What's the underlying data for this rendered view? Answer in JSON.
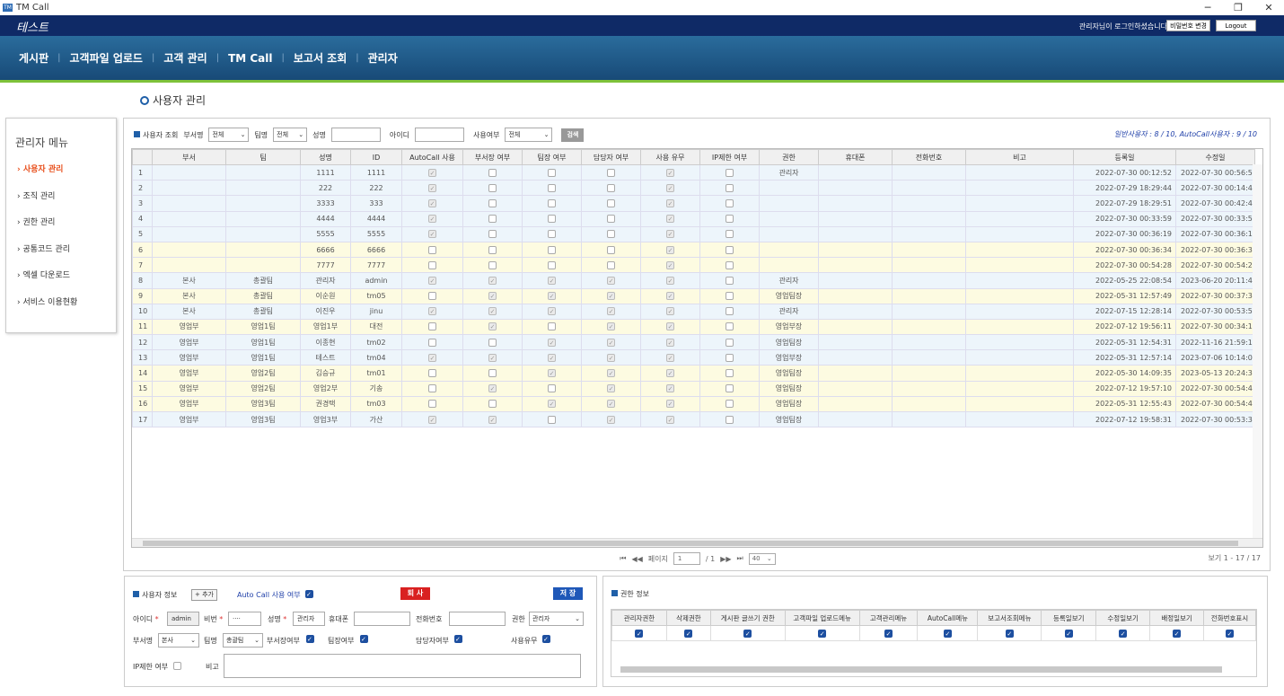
{
  "window": {
    "title": "TM Call",
    "icon": "app-icon",
    "controls": [
      "─",
      "❐",
      "✕"
    ]
  },
  "topbar": {
    "brand": "테스트",
    "login_text": "관리자님이 로그인하셨습니다",
    "change_pw": "비밀번호 변경",
    "logout": "Logout"
  },
  "nav": [
    "게시판",
    "고객파일 업로드",
    "고객 관리",
    "TM Call",
    "보고서 조회",
    "관리자"
  ],
  "page_title": "사용자 관리",
  "sidebar": {
    "title": "관리자 메뉴",
    "items": [
      "사용자 관리",
      "조직 관리",
      "권한 관리",
      "공통코드 관리",
      "엑셀 다운로드",
      "서비스 이용현황"
    ],
    "active_index": 0
  },
  "filter": {
    "section": "사용자 조회",
    "dept_label": "부서명",
    "dept_value": "전체",
    "team_label": "팀명",
    "team_value": "전체",
    "name_label": "성명",
    "id_label": "아이디",
    "use_label": "사용여부",
    "use_value": "전체",
    "search_btn": "검색"
  },
  "usercount": "일반사용자 : 8 / 10,  AutoCall사용자 : 9 / 10",
  "grid": {
    "columns": [
      "",
      "부서",
      "팀",
      "성명",
      "ID",
      "AutoCall 사용",
      "부서장 여부",
      "팀장 여부",
      "담당자 여부",
      "사용 유무",
      "IP제한 여부",
      "권한",
      "휴대폰",
      "전화번호",
      "비고",
      "등록일",
      "수정일"
    ],
    "rows": [
      {
        "no": "1",
        "dept": "",
        "team": "",
        "name": "1111",
        "id": "1111",
        "auto": true,
        "head": false,
        "lead": false,
        "mgr": false,
        "use": true,
        "ip": false,
        "role": "관리자",
        "reg": "2022-07-30 00:12:52",
        "mod": "2022-07-30 00:56:5",
        "color": "b"
      },
      {
        "no": "2",
        "dept": "",
        "team": "",
        "name": "222",
        "id": "222",
        "auto": true,
        "head": false,
        "lead": false,
        "mgr": false,
        "use": true,
        "ip": false,
        "role": "",
        "reg": "2022-07-29 18:29:44",
        "mod": "2022-07-30 00:14:4",
        "color": "b"
      },
      {
        "no": "3",
        "dept": "",
        "team": "",
        "name": "3333",
        "id": "333",
        "auto": true,
        "head": false,
        "lead": false,
        "mgr": false,
        "use": true,
        "ip": false,
        "role": "",
        "reg": "2022-07-29 18:29:51",
        "mod": "2022-07-30 00:42:4",
        "color": "b"
      },
      {
        "no": "4",
        "dept": "",
        "team": "",
        "name": "4444",
        "id": "4444",
        "auto": true,
        "head": false,
        "lead": false,
        "mgr": false,
        "use": true,
        "ip": false,
        "role": "",
        "reg": "2022-07-30 00:33:59",
        "mod": "2022-07-30 00:33:5",
        "color": "b"
      },
      {
        "no": "5",
        "dept": "",
        "team": "",
        "name": "5555",
        "id": "5555",
        "auto": true,
        "head": false,
        "lead": false,
        "mgr": false,
        "use": true,
        "ip": false,
        "role": "",
        "reg": "2022-07-30 00:36:19",
        "mod": "2022-07-30 00:36:1",
        "color": "b"
      },
      {
        "no": "6",
        "dept": "",
        "team": "",
        "name": "6666",
        "id": "6666",
        "auto": false,
        "head": false,
        "lead": false,
        "mgr": false,
        "use": true,
        "ip": false,
        "role": "",
        "reg": "2022-07-30 00:36:34",
        "mod": "2022-07-30 00:36:3",
        "color": "y"
      },
      {
        "no": "7",
        "dept": "",
        "team": "",
        "name": "7777",
        "id": "7777",
        "auto": false,
        "head": false,
        "lead": false,
        "mgr": false,
        "use": true,
        "ip": false,
        "role": "",
        "reg": "2022-07-30 00:54:28",
        "mod": "2022-07-30 00:54:2",
        "color": "y"
      },
      {
        "no": "8",
        "dept": "본사",
        "team": "총괄팀",
        "name": "관리자",
        "id": "admin",
        "auto": true,
        "head": true,
        "lead": true,
        "mgr": true,
        "use": true,
        "ip": false,
        "role": "관리자",
        "reg": "2022-05-25 22:08:54",
        "mod": "2023-06-20 20:11:4",
        "color": "b"
      },
      {
        "no": "9",
        "dept": "본사",
        "team": "총괄팀",
        "name": "이순원",
        "id": "tm05",
        "auto": false,
        "head": true,
        "lead": true,
        "mgr": true,
        "use": true,
        "ip": false,
        "role": "영업팀장",
        "reg": "2022-05-31 12:57:49",
        "mod": "2022-07-30 00:37:3",
        "color": "y"
      },
      {
        "no": "10",
        "dept": "본사",
        "team": "총괄팀",
        "name": "이진우",
        "id": "jinu",
        "auto": true,
        "head": true,
        "lead": true,
        "mgr": true,
        "use": true,
        "ip": false,
        "role": "관리자",
        "reg": "2022-07-15 12:28:14",
        "mod": "2022-07-30 00:53:5",
        "color": "b"
      },
      {
        "no": "11",
        "dept": "영업부",
        "team": "영업1팀",
        "name": "영업1부",
        "id": "대전",
        "auto": false,
        "head": true,
        "lead": false,
        "mgr": true,
        "use": true,
        "ip": false,
        "role": "영업부장",
        "reg": "2022-07-12 19:56:11",
        "mod": "2022-07-30 00:34:1",
        "color": "y"
      },
      {
        "no": "12",
        "dept": "영업부",
        "team": "영업1팀",
        "name": "이종현",
        "id": "tm02",
        "auto": false,
        "head": false,
        "lead": true,
        "mgr": true,
        "use": true,
        "ip": false,
        "role": "영업팀장",
        "reg": "2022-05-31 12:54:31",
        "mod": "2022-11-16 21:59:1",
        "color": "b"
      },
      {
        "no": "13",
        "dept": "영업부",
        "team": "영업1팀",
        "name": "테스트",
        "id": "tm04",
        "auto": true,
        "head": true,
        "lead": true,
        "mgr": true,
        "use": true,
        "ip": false,
        "role": "영업부장",
        "reg": "2022-05-31 12:57:14",
        "mod": "2023-07-06 10:14:0",
        "color": "b"
      },
      {
        "no": "14",
        "dept": "영업부",
        "team": "영업2팀",
        "name": "김승규",
        "id": "tm01",
        "auto": false,
        "head": false,
        "lead": true,
        "mgr": true,
        "use": true,
        "ip": false,
        "role": "영업팀장",
        "reg": "2022-05-30 14:09:35",
        "mod": "2023-05-13 20:24:3",
        "color": "y"
      },
      {
        "no": "15",
        "dept": "영업부",
        "team": "영업2팀",
        "name": "영업2부",
        "id": "기송",
        "auto": false,
        "head": true,
        "lead": false,
        "mgr": true,
        "use": true,
        "ip": false,
        "role": "영업팀장",
        "reg": "2022-07-12 19:57:10",
        "mod": "2022-07-30 00:54:4",
        "color": "y"
      },
      {
        "no": "16",
        "dept": "영업부",
        "team": "영업3팀",
        "name": "권경택",
        "id": "tm03",
        "auto": false,
        "head": false,
        "lead": true,
        "mgr": true,
        "use": true,
        "ip": false,
        "role": "영업팀장",
        "reg": "2022-05-31 12:55:43",
        "mod": "2022-07-30 00:54:4",
        "color": "y"
      },
      {
        "no": "17",
        "dept": "영업부",
        "team": "영업3팀",
        "name": "영업3부",
        "id": "가산",
        "auto": true,
        "head": true,
        "lead": false,
        "mgr": true,
        "use": true,
        "ip": false,
        "role": "영업팀장",
        "reg": "2022-07-12 19:58:31",
        "mod": "2022-07-30 00:53:3",
        "color": "b"
      }
    ]
  },
  "pager": {
    "first": "⏮",
    "prev": "◀◀",
    "page_label": "페이지",
    "page_value": "1",
    "total": "/ 1",
    "next": "▶▶",
    "last": "⏭",
    "page_size": "40",
    "info": "보기 1 - 17 / 17"
  },
  "user_info": {
    "section": "사용자 정보",
    "add_btn": "+ 추가",
    "autocall_label": "Auto Call 사용 여부",
    "resign_btn": "퇴 사",
    "save_btn": "저 장",
    "id_label": "아이디",
    "id_value": "admin",
    "pw_label": "비번",
    "pw_value": "····",
    "name_label": "성명",
    "name_value": "관리자",
    "phone_label": "휴대폰",
    "tel_label": "전화번호",
    "role_label": "권한",
    "role_value": "관리자",
    "dept_label": "부서명",
    "dept_value": "본사",
    "team_label": "팀명",
    "team_value": "총괄팀",
    "head_label": "부서장여부",
    "lead_label": "팀장여부",
    "mgr_label": "담당자여부",
    "use_label": "사용유무",
    "ip_label": "IP제한 여부",
    "note_label": "비고"
  },
  "perm_info": {
    "section": "권한 정보",
    "columns": [
      "관리자권한",
      "삭제권한",
      "게시판 글쓰기 권한",
      "고객파일 업로드메뉴",
      "고객관리메뉴",
      "AutoCall메뉴",
      "보고서조회메뉴",
      "등록일보기",
      "수정일보기",
      "배정일보기",
      "전화번호표시"
    ]
  }
}
